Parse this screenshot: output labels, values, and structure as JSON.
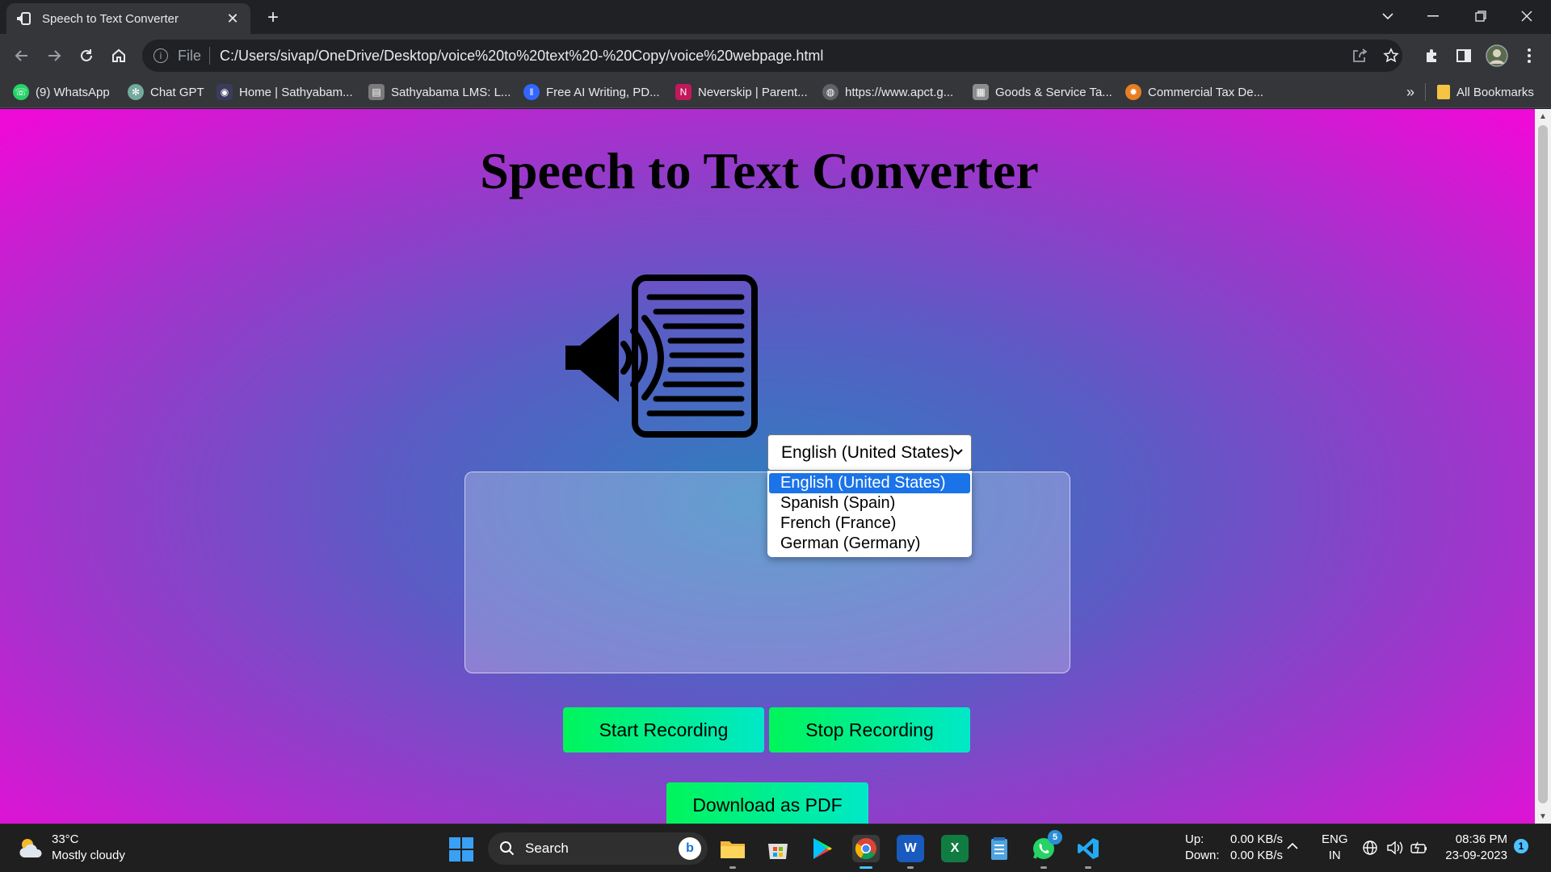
{
  "browser": {
    "tab_title": "Speech to Text Converter",
    "url_scheme": "File",
    "url": "C:/Users/sivap/OneDrive/Desktop/voice%20to%20text%20-%20Copy/voice%20webpage.html",
    "bookmarks": [
      {
        "label": "(9) WhatsApp",
        "color": "#25d366"
      },
      {
        "label": "Chat GPT",
        "color": "#74aa9c"
      },
      {
        "label": "Home | Sathyabam...",
        "color": "#3b3b5c"
      },
      {
        "label": "Sathyabama LMS: L...",
        "color": "#7a7a7a"
      },
      {
        "label": "Free AI Writing, PD...",
        "color": "#3366ff"
      },
      {
        "label": "Neverskip | Parent...",
        "color": "#c2185b"
      },
      {
        "label": "https://www.apct.g...",
        "color": "#5f6368"
      },
      {
        "label": "Goods & Service Ta...",
        "color": "#8d8d8d"
      },
      {
        "label": "Commercial Tax De...",
        "color": "#e67e22"
      }
    ],
    "more_bookmarks": "»",
    "all_bookmarks": "All Bookmarks"
  },
  "page": {
    "title": "Speech to Text Converter",
    "language": {
      "selected": "English (United States)",
      "options": [
        "English (United States)",
        "Spanish (Spain)",
        "French (France)",
        "German (Germany)"
      ]
    },
    "transcript": "",
    "buttons": {
      "start": "Start Recording",
      "stop": "Stop Recording",
      "download": "Download as PDF"
    },
    "button_gradient": [
      "#00f55a",
      "#00e8c8"
    ]
  },
  "taskbar": {
    "weather_temp": "33°C",
    "weather_desc": "Mostly cloudy",
    "search_label": "Search",
    "whatsapp_badge": "5",
    "net_up_label": "Up:",
    "net_up_value": "0.00 KB/s",
    "net_down_label": "Down:",
    "net_down_value": "0.00 KB/s",
    "lang_line1": "ENG",
    "lang_line2": "IN",
    "time": "08:36 PM",
    "date": "23-09-2023",
    "notification_count": "1"
  }
}
